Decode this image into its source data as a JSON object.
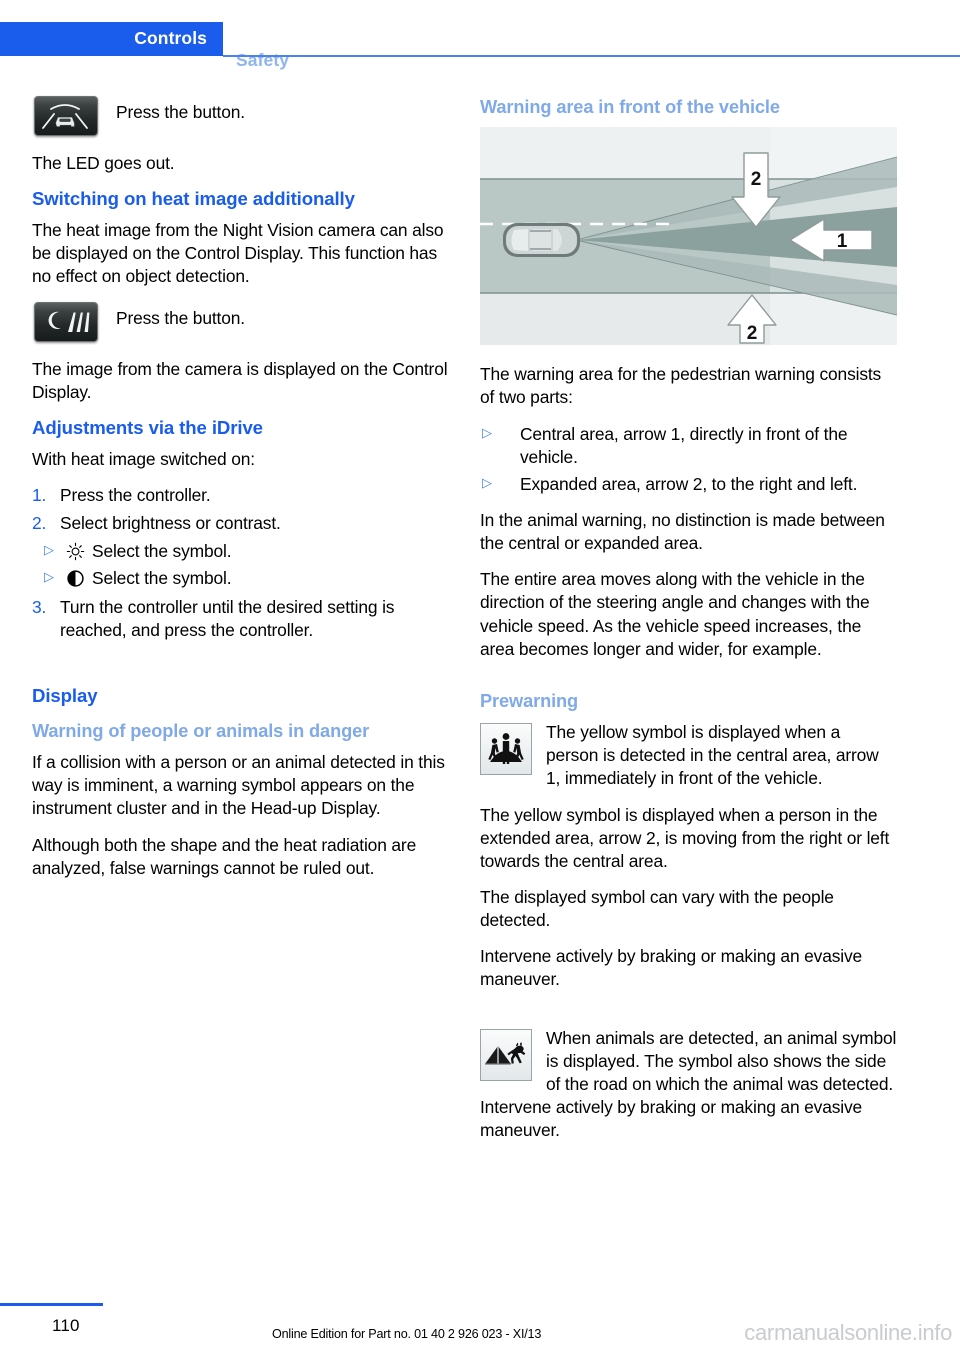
{
  "header": {
    "active_tab": "Controls",
    "inactive_tab": "Safety",
    "active_color": "#1a5cec",
    "inactive_color": "#8fb4ee"
  },
  "left_column": {
    "night_vision_button": {
      "icon": "night-vision-button-icon",
      "caption": "Press the button."
    },
    "led_text": "The LED goes out.",
    "heading_heat_image": "Switching on heat image additionally",
    "heat_image_para": "The heat image from the Night Vision camera can also be displayed on the Control Display. This function has no effect on object detection.",
    "heat_image_button": {
      "icon": "heat-image-button-icon",
      "caption": "Press the button."
    },
    "camera_image_para": "The image from the camera is displayed on the Control Display.",
    "heading_idrive": "Adjustments via the iDrive",
    "idrive_intro": "With heat image switched on:",
    "steps": [
      {
        "num": "1.",
        "text": "Press the controller."
      },
      {
        "num": "2.",
        "text": "Select brightness or contrast."
      },
      {
        "num": "3.",
        "text": "Turn the controller until the desired setting is reached, and press the controller."
      }
    ],
    "symbol_options": [
      {
        "marker": "▷",
        "symbol": "brightness-sun-icon",
        "text": "Select the symbol."
      },
      {
        "marker": "▷",
        "symbol": "contrast-half-circle-icon",
        "text": "Select the symbol."
      }
    ],
    "heading_display": "Display",
    "heading_warning_people": "Warning of people or animals in danger",
    "collision_para": "If a collision with a person or an animal detected in this way is imminent, a warning symbol appears on the instrument cluster and in the Head-up Display.",
    "false_warnings_para": "Although both the shape and the heat radiation are analyzed, false warnings cannot be ruled out."
  },
  "right_column": {
    "heading_warning_area": "Warning area in front of the vehicle",
    "figure": {
      "name": "warning-area-diagram",
      "labels": [
        "2",
        "1",
        "2"
      ],
      "road_color": "#b9c7c5",
      "central_cone_color": "#8fa5a2",
      "expanded_cone_color": "#aebebb",
      "background_color": "#eef1f1"
    },
    "warning_area_intro": "The warning area for the pedestrian warning consists of two parts:",
    "warning_area_bullets": [
      {
        "marker": "▷",
        "text": "Central area, arrow 1, directly in front of the vehicle."
      },
      {
        "marker": "▷",
        "text": "Expanded area, arrow 2, to the right and left."
      }
    ],
    "animal_warning_para": "In the animal warning, no distinction is made between the central or expanded area.",
    "entire_area_para": "The entire area moves along with the vehicle in the direction of the steering angle and changes with the vehicle speed. As the vehicle speed increases, the area becomes longer and wider, for example.",
    "heading_prewarning": "Prewarning",
    "pedestrian_block": {
      "icon": "pedestrian-warning-icon",
      "text": "The yellow symbol is displayed when a person is detected in the central area, arrow 1, immediately in front of the vehicle."
    },
    "extended_area_para": "The yellow symbol is displayed when a person in the extended area, arrow 2, is moving from the right or left towards the central area.",
    "symbol_vary_para": "The displayed symbol can vary with the people detected.",
    "intervene_para": "Intervene actively by braking or making an evasive maneuver.",
    "animal_block": {
      "icon": "animal-warning-icon",
      "text": "When animals are detected, an animal symbol is displayed. The symbol also shows the side of the road on which the animal was detected. Intervene actively by braking or making an evasive maneuver."
    }
  },
  "footer": {
    "page_number": "110",
    "edition": "Online Edition for Part no. 01 40 2 926 023 - XI/13",
    "watermark": "carmanualsonline.info"
  }
}
